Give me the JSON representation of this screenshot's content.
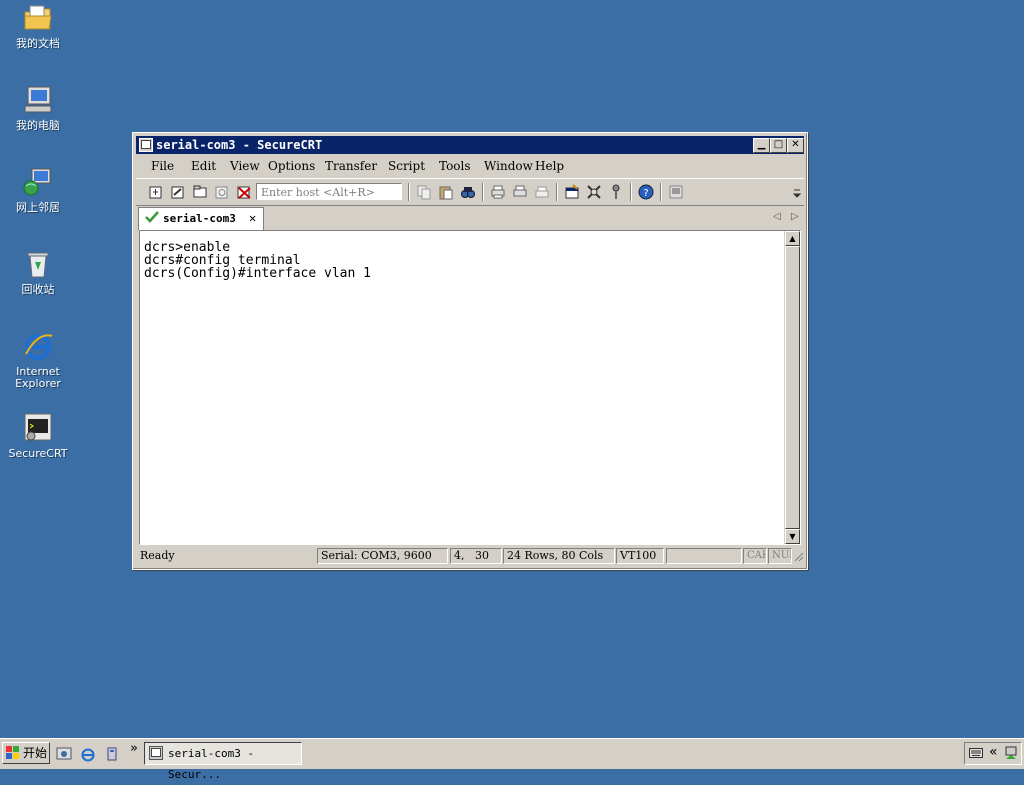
{
  "desktop": {
    "icons": [
      {
        "label": "我的文档"
      },
      {
        "label": "我的电脑"
      },
      {
        "label": "网上邻居"
      },
      {
        "label": "回收站"
      },
      {
        "label": "Internet Explorer"
      },
      {
        "label": "SecureCRT"
      }
    ]
  },
  "window": {
    "title": "serial-com3 - SecureCRT",
    "menu": [
      "File",
      "Edit",
      "View",
      "Options",
      "Transfer",
      "Script",
      "Tools",
      "Window",
      "Help"
    ],
    "host_placeholder": "Enter host <Alt+R>",
    "tab_label": "serial-com3",
    "terminal_lines": [
      "dcrs>enable",
      "dcrs#config terminal",
      "dcrs(Config)#interface vlan 1"
    ],
    "status": {
      "ready": "Ready",
      "connection": "Serial: COM3, 9600",
      "cursor": "4,   30",
      "size": "24 Rows, 80 Cols",
      "emulation": "VT100",
      "cap": "CAP",
      "num": "NUM"
    }
  },
  "taskbar": {
    "start_label": "开始",
    "task_item": "serial-com3 - Secur...",
    "chevron": "»",
    "tray_chevron": "«"
  },
  "colors": {
    "desktop": "#3a6ea5",
    "titlebar": "#0a246a",
    "chrome": "#d4d0c8"
  }
}
